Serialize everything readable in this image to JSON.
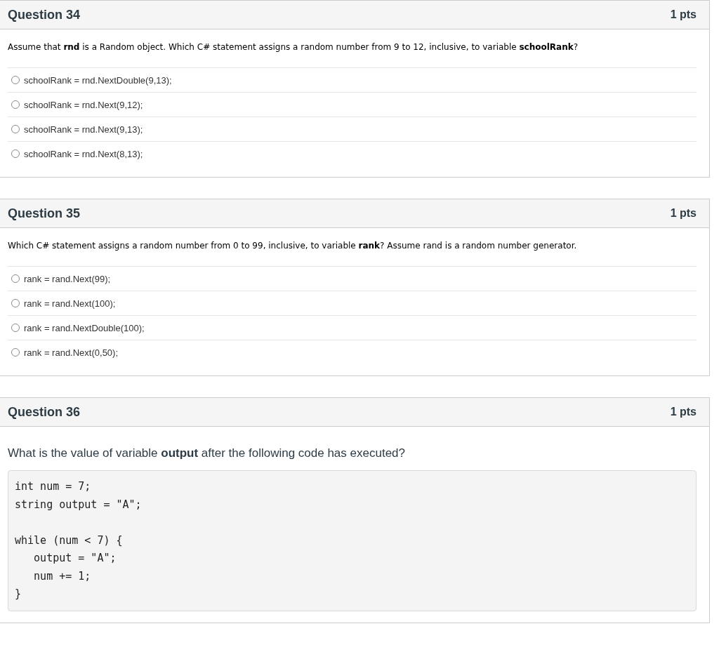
{
  "questions": [
    {
      "title": "Question 34",
      "points": "1 pts",
      "kind": "choice",
      "prompt": "Assume that **rnd** is a Random object. Which C# statement assigns a random number from 9 to 12, inclusive, to variable **schoolRank**?",
      "answers": [
        {
          "text": "schoolRank = rnd.NextDouble(9,13);",
          "selected": false
        },
        {
          "text": "schoolRank = rnd.Next(9,12);",
          "selected": false
        },
        {
          "text": "schoolRank = rnd.Next(9,13);",
          "selected": false
        },
        {
          "text": "schoolRank = rnd.Next(8,13);",
          "selected": false
        }
      ]
    },
    {
      "title": "Question 35",
      "points": "1 pts",
      "kind": "choice",
      "prompt": "Which C# statement assigns a random number from 0 to 99, inclusive, to variable **rank**? Assume rand is a random number generator.",
      "answers": [
        {
          "text": "rank = rand.Next(99);",
          "selected": false
        },
        {
          "text": "rank = rand.Next(100);",
          "selected": false
        },
        {
          "text": "rank = rand.NextDouble(100);",
          "selected": false
        },
        {
          "text": "rank = rand.Next(0,50);",
          "selected": false
        }
      ]
    },
    {
      "title": "Question 36",
      "points": "1 pts",
      "kind": "code",
      "prompt": "What is the value of variable **output** after the following code has executed?",
      "code": "int num = 7;\nstring output = \"A\";\n\nwhile (num < 7) {\n   output = \"A\";\n   num += 1;\n}"
    }
  ]
}
